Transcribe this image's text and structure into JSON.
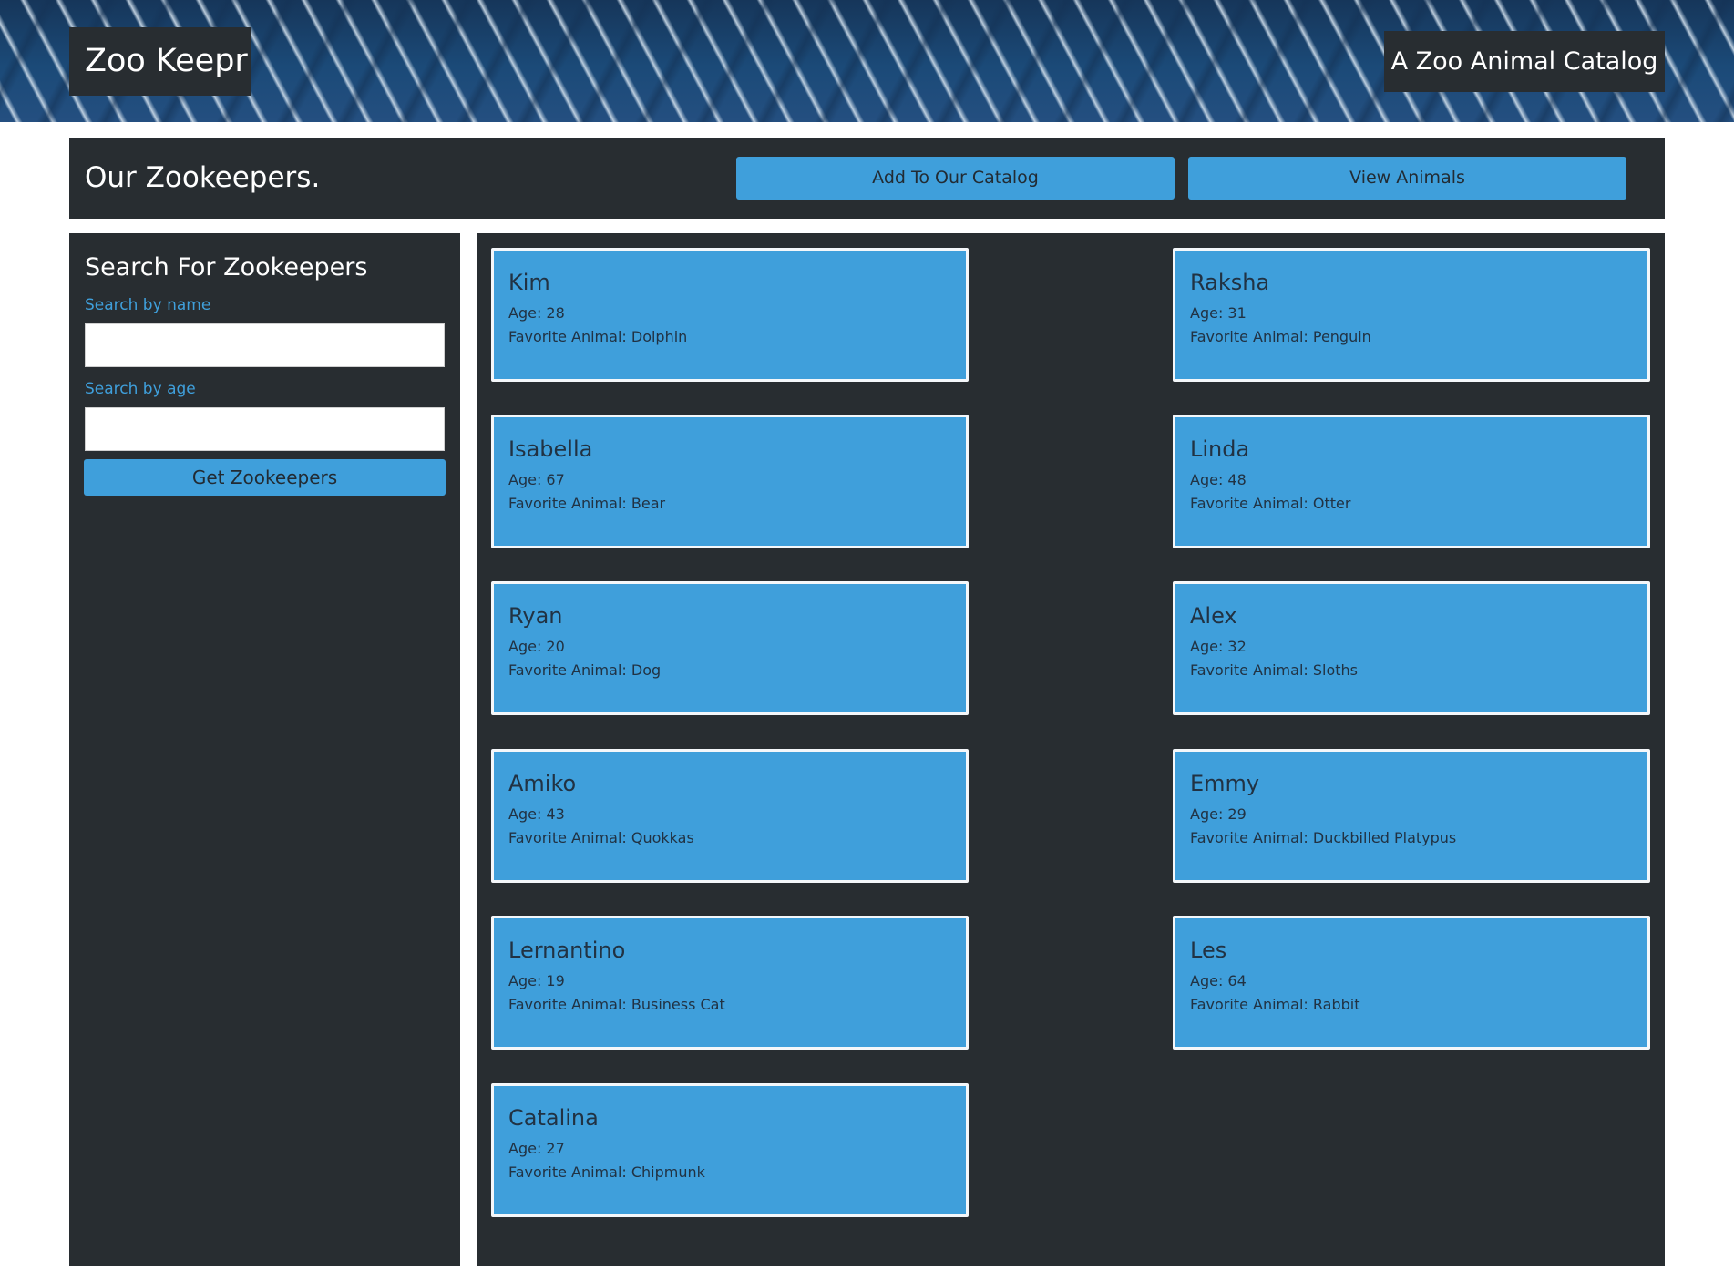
{
  "header": {
    "brand": "Zoo Keepr",
    "tagline": "A Zoo Animal Catalog"
  },
  "topbar": {
    "title": "Our Zookeepers.",
    "add_label": "Add To Our Catalog",
    "view_label": "View Animals"
  },
  "search": {
    "title": "Search For Zookeepers",
    "name_label": "Search by name",
    "name_value": "",
    "age_label": "Search by age",
    "age_value": "",
    "button_label": "Get Zookeepers"
  },
  "keepers": [
    {
      "name": "Kim",
      "age": "Age: 28",
      "favorite": "Favorite Animal: Dolphin"
    },
    {
      "name": "Raksha",
      "age": "Age: 31",
      "favorite": "Favorite Animal: Penguin"
    },
    {
      "name": "Isabella",
      "age": "Age: 67",
      "favorite": "Favorite Animal: Bear"
    },
    {
      "name": "Linda",
      "age": "Age: 48",
      "favorite": "Favorite Animal: Otter"
    },
    {
      "name": "Ryan",
      "age": "Age: 20",
      "favorite": "Favorite Animal: Dog"
    },
    {
      "name": "Alex",
      "age": "Age: 32",
      "favorite": "Favorite Animal: Sloths"
    },
    {
      "name": "Amiko",
      "age": "Age: 43",
      "favorite": "Favorite Animal: Quokkas"
    },
    {
      "name": "Emmy",
      "age": "Age: 29",
      "favorite": "Favorite Animal: Duckbilled Platypus"
    },
    {
      "name": "Lernantino",
      "age": "Age: 19",
      "favorite": "Favorite Animal: Business Cat"
    },
    {
      "name": "Les",
      "age": "Age: 64",
      "favorite": "Favorite Animal: Rabbit"
    },
    {
      "name": "Catalina",
      "age": "Age: 27",
      "favorite": "Favorite Animal: Chipmunk"
    }
  ]
}
